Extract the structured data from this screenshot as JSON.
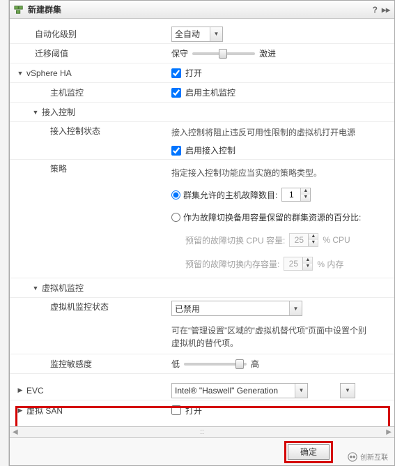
{
  "title": "新建群集",
  "automation": {
    "label": "自动化级别",
    "value": "全自动"
  },
  "migration": {
    "label": "迁移阈值",
    "left": "保守",
    "right": "激进"
  },
  "ha": {
    "label": "vSphere HA",
    "checkbox": "打开"
  },
  "hostmon": {
    "label": "主机监控",
    "checkbox": "启用主机监控"
  },
  "admission": {
    "header": "接入控制",
    "status_label": "接入控制状态",
    "desc": "接入控制将阻止违反可用性限制的虚拟机打开电源",
    "enable": "启用接入控制",
    "policy_label": "策略",
    "policy_desc": "指定接入控制功能应当实施的策略类型。",
    "opt1": "群集允许的主机故障数目:",
    "opt1_val": "1",
    "opt2": "作为故障切换备用容量保留的群集资源的百分比:",
    "cpu_label": "预留的故障切换 CPU 容量:",
    "cpu_val": "25",
    "cpu_unit": "%  CPU",
    "mem_label": "预留的故障切换内存容量:",
    "mem_val": "25",
    "mem_unit": "%  内存"
  },
  "vmmon": {
    "header": "虚拟机监控",
    "status_label": "虚拟机监控状态",
    "value": "已禁用",
    "desc": "可在“管理设置”区域的“虚拟机替代项”页面中设置个别虚拟机的替代项。",
    "sens_label": "监控敏感度",
    "low": "低",
    "high": "高"
  },
  "evc": {
    "label": "EVC",
    "value": "Intel® \"Haswell\" Generation"
  },
  "vsan": {
    "label": "虚拟 SAN",
    "checkbox": "打开"
  },
  "buttons": {
    "ok": "确定"
  },
  "logo": "创新互联"
}
